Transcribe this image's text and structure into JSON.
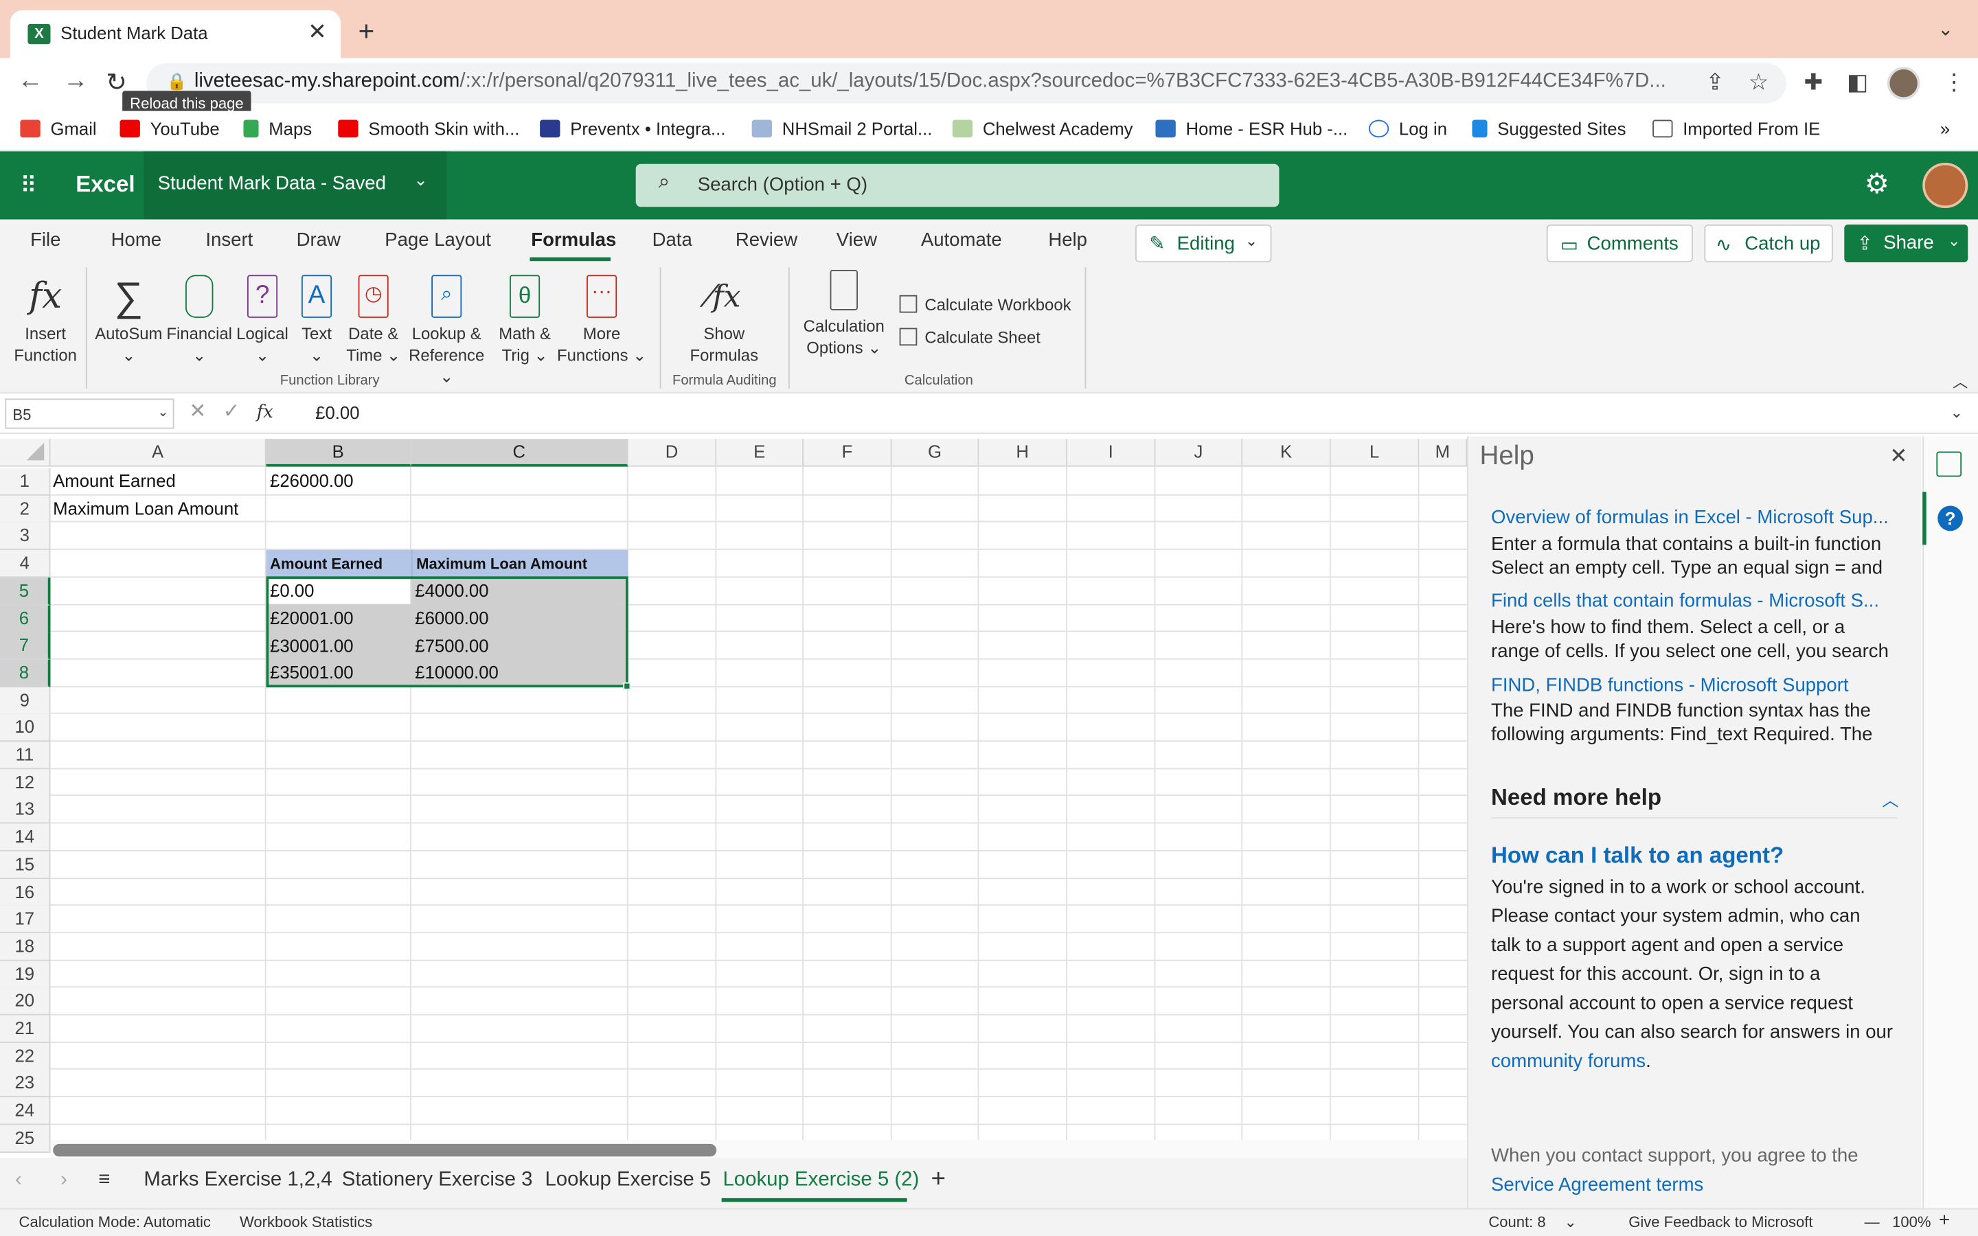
{
  "browser": {
    "tab_title": "Student Mark Data",
    "tab_close": "✕",
    "new_tab": "+",
    "tooltip": "Reload this page",
    "url_host": "liveteesac-my.sharepoint.com",
    "url_path": "/:x:/r/personal/q2079311_live_tees_ac_uk/_layouts/15/Doc.aspx?sourcedoc=%7B3CFC7333-62E3-4CB5-A30B-B912F44CE34F%7D...",
    "bookmarks": [
      "Gmail",
      "YouTube",
      "Maps",
      "Smooth Skin with...",
      "Preventx • Integra...",
      "NHSmail 2 Portal...",
      "Chelwest Academy",
      "Home - ESR Hub -...",
      "Log in",
      "Suggested Sites",
      "Imported From IE"
    ],
    "bookmarks_more": "»"
  },
  "excel": {
    "app_name": "Excel",
    "doc_title": "Student Mark Data  -  Saved",
    "search_placeholder": "Search (Option + Q)",
    "ribbon_tabs": [
      "File",
      "Home",
      "Insert",
      "Draw",
      "Page Layout",
      "Formulas",
      "Data",
      "Review",
      "View",
      "Automate",
      "Help"
    ],
    "active_tab": "Formulas",
    "editing_label": "Editing",
    "comments_label": "Comments",
    "catchup_label": "Catch up",
    "share_label": "Share",
    "ribbon": {
      "insert_function": [
        "Insert",
        "Function"
      ],
      "autosum": "AutoSum",
      "financial": "Financial",
      "logical": "Logical",
      "text": "Text",
      "date_time": [
        "Date &",
        "Time"
      ],
      "lookup": [
        "Lookup &",
        "Reference"
      ],
      "math": [
        "Math &",
        "Trig"
      ],
      "more": [
        "More",
        "Functions"
      ],
      "show_formulas": [
        "Show",
        "Formulas"
      ],
      "calc_options": [
        "Calculation",
        "Options"
      ],
      "calc_workbook": "Calculate Workbook",
      "calc_sheet": "Calculate Sheet",
      "group_function_library": "Function Library",
      "group_formula_auditing": "Formula Auditing",
      "group_calculation": "Calculation"
    },
    "name_box": "B5",
    "formula_value": "£0.00",
    "columns": [
      "A",
      "B",
      "C",
      "D",
      "E",
      "F",
      "G",
      "H",
      "I",
      "J",
      "K",
      "L",
      "M"
    ],
    "rows": [
      "1",
      "2",
      "3",
      "4",
      "5",
      "6",
      "7",
      "8",
      "9",
      "10",
      "11",
      "12",
      "13",
      "14",
      "15",
      "16",
      "17",
      "18",
      "19",
      "20",
      "21",
      "22",
      "23",
      "24",
      "25"
    ],
    "cells": {
      "A1": "Amount Earned",
      "B1": "£26000.00",
      "A2": "Maximum Loan Amount",
      "B4": "Amount Earned",
      "C4": "Maximum Loan Amount",
      "B5": "£0.00",
      "C5": "£4000.00",
      "B6": "£20001.00",
      "C6": "£6000.00",
      "B7": "£30001.00",
      "C7": "£7500.00",
      "B8": "£35001.00",
      "C8": "£10000.00"
    },
    "sheets": [
      "Marks Exercise 1,2,4",
      "Stationery Exercise 3",
      "Lookup Exercise 5",
      "Lookup Exercise 5 (2)"
    ],
    "active_sheet": "Lookup Exercise 5 (2)",
    "status": {
      "calc_mode": "Calculation Mode: Automatic",
      "workbook_stats": "Workbook Statistics",
      "count": "Count: 8",
      "feedback": "Give Feedback to Microsoft",
      "zoom": "100%"
    }
  },
  "help_pane": {
    "title": "Help",
    "results": [
      {
        "link": "Overview of formulas in Excel - Microsoft Sup...",
        "lines": [
          "Enter a formula that contains a built-in function",
          "Select an empty cell. Type an equal sign = and"
        ]
      },
      {
        "link": "Find cells that contain formulas - Microsoft S...",
        "lines": [
          "Here's how to find them. Select a cell, or a",
          "range of cells. If you select one cell, you search"
        ]
      },
      {
        "link": "FIND, FINDB functions - Microsoft Support",
        "lines": [
          "The FIND and FINDB function syntax has the",
          "following arguments: Find_text Required. The"
        ]
      }
    ],
    "need_more_help": "Need more help",
    "agent_question": "How can I talk to an agent?",
    "agent_body": "You're signed in to a work or school account. Please contact your system admin, who can talk to a support agent and open a service request for this account. Or, sign in to a personal account to open a service request yourself. You can also search for answers in our",
    "community_link": "community forums",
    "contact_text": "When you contact support, you agree to the",
    "terms_link": "Service Agreement terms"
  }
}
